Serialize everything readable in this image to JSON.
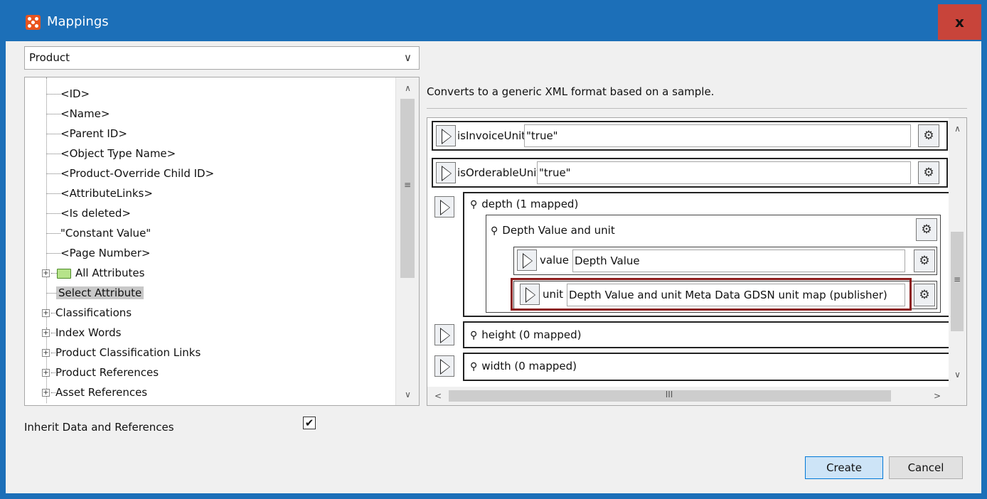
{
  "window": {
    "title": "Mappings",
    "close_label": "x"
  },
  "combo": {
    "value": "Product"
  },
  "tree": {
    "items": [
      "<ID>",
      "<Name>",
      "<Parent ID>",
      "<Object Type Name>",
      "<Product-Override Child ID>",
      "<AttributeLinks>",
      "<Is deleted>",
      "\"Constant Value\"",
      "<Page Number>",
      "All Attributes",
      "Select Attribute",
      "Classifications",
      "Index Words",
      "Product Classification Links",
      "Product References",
      "Asset References"
    ]
  },
  "inherit": {
    "label": "Inherit Data and References",
    "checked": true,
    "check_glyph": "✔"
  },
  "description": "Converts to a generic XML format based on a sample.",
  "mapping": {
    "invoice": {
      "label": "isInvoiceUnit",
      "value": "\"true\""
    },
    "orderable": {
      "label": "isOrderableUnit",
      "value": "\"true\""
    },
    "depth": {
      "label": "depth (1 mapped)"
    },
    "depth_group": {
      "label": "Depth Value and unit"
    },
    "depth_value": {
      "label": "value",
      "value": "Depth Value"
    },
    "depth_unit": {
      "label": "unit",
      "value": "Depth Value and unit Meta Data GDSN unit map (publisher)"
    },
    "height": {
      "label": "height (0 mapped)"
    },
    "width": {
      "label": "width (0 mapped)"
    }
  },
  "buttons": {
    "create": "Create",
    "cancel": "Cancel"
  },
  "colors": {
    "titlebar": "#1c6fb8",
    "close": "#c8443a",
    "highlight": "#8b1a1a"
  }
}
